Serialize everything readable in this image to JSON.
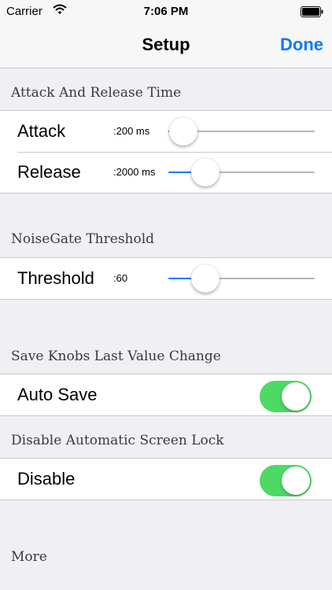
{
  "status_bar": {
    "carrier": "Carrier",
    "time": "7:06 PM",
    "icons": [
      "wifi-icon",
      "battery-icon"
    ]
  },
  "nav": {
    "title": "Setup",
    "done_label": "Done"
  },
  "colors": {
    "accent": "#0a7aff",
    "toggle_on": "#4cd964",
    "background": "#efeff4"
  },
  "sections": {
    "attack_release": {
      "header": "Attack And Release Time",
      "attack": {
        "label": "Attack",
        "value": ":200 ms",
        "fraction": 0.1
      },
      "release": {
        "label": "Release",
        "value": ":2000 ms",
        "fraction": 0.25
      }
    },
    "noisegate": {
      "header": "NoiseGate Threshold",
      "threshold": {
        "label": "Threshold",
        "value": ":60",
        "fraction": 0.25
      }
    },
    "save_knobs": {
      "header": "Save Knobs Last Value Change",
      "auto_save": {
        "label": "Auto Save",
        "on": true
      }
    },
    "screen_lock": {
      "header": "Disable Automatic Screen Lock",
      "disable": {
        "label": "Disable",
        "on": true
      }
    },
    "more": {
      "header": "More"
    }
  }
}
